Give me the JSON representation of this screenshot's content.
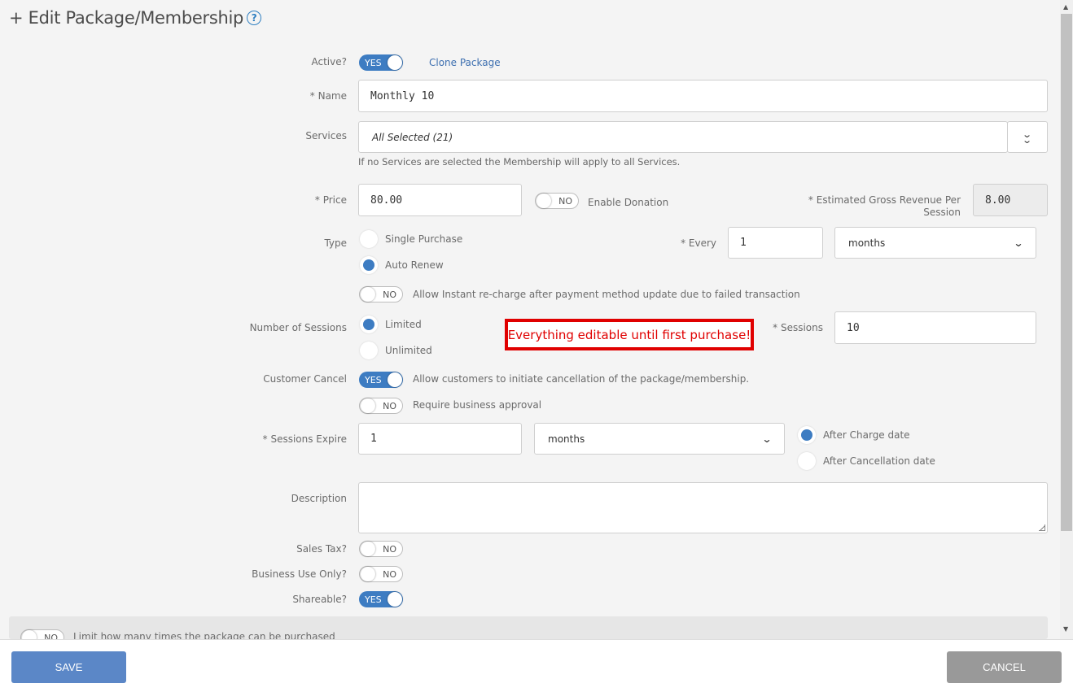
{
  "header": {
    "title": "+ Edit Package/Membership",
    "help_icon": "question-circle-icon"
  },
  "active": {
    "label": "Active?",
    "toggle": "YES",
    "clone_link": "Clone Package"
  },
  "name": {
    "label": "* Name",
    "value": "Monthly 10"
  },
  "services": {
    "label": "Services",
    "value": "All Selected (21)",
    "hint": "If no Services are selected the Membership will apply to all Services.",
    "expand_icon": "double-chevron-down-icon"
  },
  "price": {
    "label": "* Price",
    "value": "80.00",
    "donation_toggle": "NO",
    "donation_label": "Enable Donation"
  },
  "estimated_revenue": {
    "label_line1": "* Estimated Gross Revenue Per",
    "label_line2": "Session",
    "value": "8.00"
  },
  "type": {
    "label": "Type",
    "options": [
      "Single Purchase",
      "Auto Renew"
    ],
    "selected": "Auto Renew",
    "every_label": "* Every",
    "every_value": "1",
    "every_unit": "months"
  },
  "instant_recharge": {
    "toggle": "NO",
    "label": "Allow Instant re-charge after payment method update due to failed transaction"
  },
  "sessions": {
    "label": "Number of Sessions",
    "options": [
      "Limited",
      "Unlimited"
    ],
    "selected": "Limited",
    "count_label": "* Sessions",
    "count_value": "10"
  },
  "callout": {
    "text": "Everything editable until first purchase!",
    "color": "#e00000"
  },
  "customer_cancel": {
    "label": "Customer Cancel",
    "toggle": "YES",
    "description": "Allow customers to initiate cancellation of the package/membership.",
    "approval_toggle": "NO",
    "approval_label": "Require business approval"
  },
  "sessions_expire": {
    "label": "* Sessions Expire",
    "value": "1",
    "unit": "months",
    "options": [
      "After Charge date",
      "After Cancellation date"
    ],
    "selected": "After Charge date"
  },
  "description": {
    "label": "Description",
    "value": ""
  },
  "sales_tax": {
    "label": "Sales Tax?",
    "toggle": "NO"
  },
  "business_use": {
    "label": "Business Use Only?",
    "toggle": "NO"
  },
  "shareable": {
    "label": "Shareable?",
    "toggle": "YES"
  },
  "limit": {
    "toggle": "NO",
    "label": "Limit how many times the package can be purchased"
  },
  "footer": {
    "save_label": "SAVE",
    "cancel_label": "CANCEL"
  },
  "colors": {
    "accent": "#3d7cc2",
    "save_button": "#5b87c7",
    "cancel_button": "#999999"
  }
}
